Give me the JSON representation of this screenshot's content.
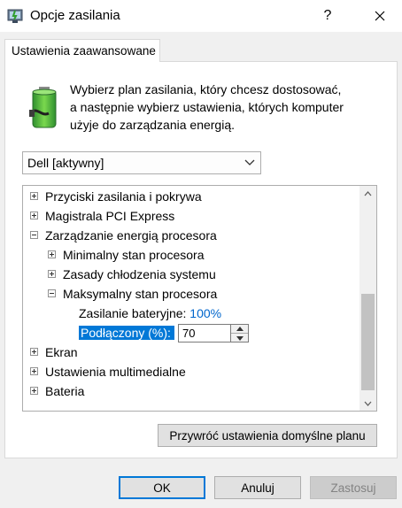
{
  "window": {
    "title": "Opcje zasilania",
    "help_label": "?"
  },
  "tabs": [
    {
      "label": "Ustawienia zaawansowane"
    }
  ],
  "intro": {
    "line1": "Wybierz plan zasilania, który chcesz dostosować,",
    "line2": "a następnie wybierz ustawienia, których komputer",
    "line3": "użyje do zarządzania energią."
  },
  "plan_select": {
    "value": "Dell [aktywny]"
  },
  "tree": {
    "items": [
      {
        "label": "Przyciski zasilania i pokrywa"
      },
      {
        "label": "Magistrala PCI Express"
      },
      {
        "label": "Zarządzanie energią procesora"
      },
      {
        "label": "Minimalny stan procesora"
      },
      {
        "label": "Zasady chłodzenia systemu"
      },
      {
        "label": "Maksymalny stan procesora"
      },
      {
        "label": "Zasilanie bateryjne:",
        "value": "100%"
      },
      {
        "label": "Podłączony (%):",
        "value": "70"
      },
      {
        "label": "Ekran"
      },
      {
        "label": "Ustawienia multimedialne"
      },
      {
        "label": "Bateria"
      }
    ]
  },
  "buttons": {
    "restore": "Przywróć ustawienia domyślne planu",
    "ok": "OK",
    "cancel": "Anuluj",
    "apply": "Zastosuj"
  }
}
